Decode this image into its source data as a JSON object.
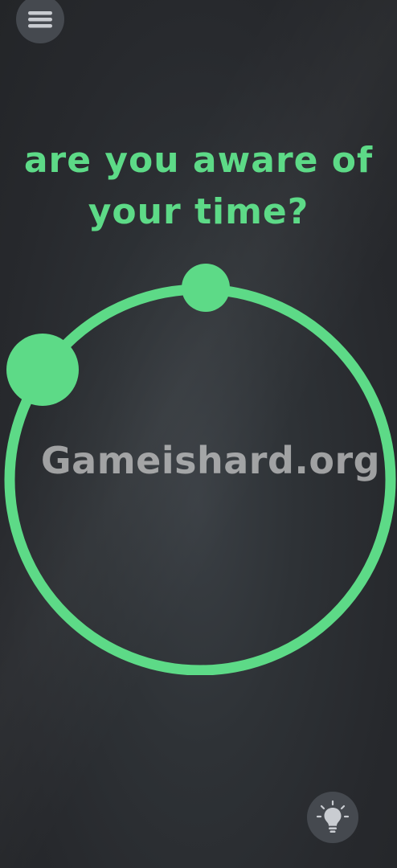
{
  "colors": {
    "accent": "#5dda87",
    "button_bg": "#45494f",
    "icon": "#c9ccd1"
  },
  "menu": {
    "icon": "hamburger-icon"
  },
  "question": {
    "line1": "are you aware of",
    "line2": "your time?"
  },
  "watermark": {
    "text": "Gameishard.org"
  },
  "hint": {
    "icon": "lightbulb-icon"
  }
}
